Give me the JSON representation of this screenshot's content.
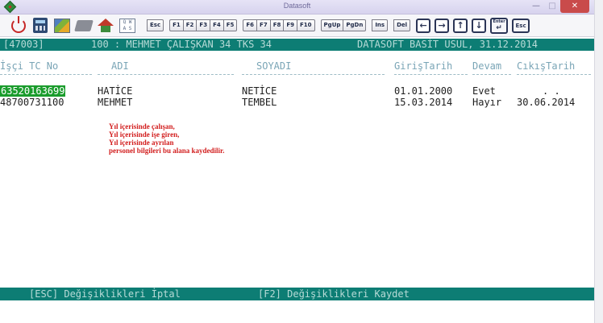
{
  "window": {
    "title": "Datasoft",
    "minimize_glyph": "—",
    "maximize_glyph": "□",
    "close_glyph": "✕"
  },
  "toolbar": {
    "icons": [
      "power-icon",
      "calculator-icon",
      "spreadsheet-icon",
      "folder-icon",
      "home-icon",
      "grid-icon"
    ],
    "grid_icon_text": "Q W A S",
    "esc_label": "Esc",
    "fkeys_a": [
      "F1",
      "F2",
      "F3",
      "F4",
      "F5"
    ],
    "fkeys_b": [
      "F6",
      "F7",
      "F8",
      "F9",
      "F10"
    ],
    "nav_keys": [
      "PgUp",
      "PgDn"
    ],
    "ins_label": "Ins",
    "del_label": "Del",
    "arrow_left": "←",
    "arrow_right": "→",
    "arrow_up": "↑",
    "arrow_down": "↓",
    "enter_label": "Enter",
    "enter_arrow": "↵",
    "esc2_label": "Esc"
  },
  "status_top": {
    "left": "[47003]",
    "company": "100 : MEHMET ÇALIŞKAN 34 TKS 34",
    "right": "DATASOFT BASİT USUL, 31.12.2014"
  },
  "columns": {
    "tc": "İşçi TC No",
    "name": "ADI",
    "surname": "SOYADI",
    "start": "GirişTarih",
    "status": "Devam",
    "end": "CıkışTarih"
  },
  "rows": [
    {
      "tc": "63520163699",
      "name": "HATİCE",
      "surname": "NETİCE",
      "start": "01.01.2000",
      "status": "Evet",
      "end": ". ."
    },
    {
      "tc": "48700731100",
      "name": "MEHMET",
      "surname": "TEMBEL",
      "start": "15.03.2014",
      "status": "Hayır",
      "end": "30.06.2014"
    }
  ],
  "note_lines": [
    "Yıl içerisinde çalışan,",
    "Yıl içerisinde işe giren,",
    "Yıl içerisinde ayrılan",
    "personel bilgileri bu alana kaydedilir."
  ],
  "status_bottom": {
    "esc": "[ESC] Değişiklikleri İptal",
    "f2": "[F2] Değişiklikleri Kaydet"
  },
  "colors": {
    "status_bar": "#0d7d74",
    "selected_cell": "#1a9c2c",
    "note_text": "#d21d1d"
  }
}
